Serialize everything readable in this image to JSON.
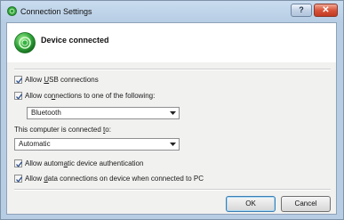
{
  "window": {
    "title": "Connection Settings",
    "help_label": "?",
    "close_label": "✕"
  },
  "header": {
    "status_text": "Device connected",
    "status_icon": "green-connected-orb-icon",
    "accent_color": "#2fa33a"
  },
  "options": {
    "allow_usb": {
      "checked": true,
      "pre": "Allow ",
      "key": "U",
      "post": "SB connections"
    },
    "allow_connections": {
      "checked": true,
      "pre": "Allow co",
      "key": "n",
      "post": "nections to one of the following:"
    },
    "connection_type": {
      "value": "Bluetooth"
    },
    "connected_to_label": {
      "pre": "This computer is connected ",
      "key": "t",
      "post": "o:"
    },
    "connected_to": {
      "value": "Automatic"
    },
    "allow_auth": {
      "checked": true,
      "pre": "Allow autom",
      "key": "a",
      "post": "tic device authentication"
    },
    "allow_data": {
      "checked": true,
      "pre": "Allow ",
      "key": "d",
      "post": "ata connections on device when connected to PC"
    }
  },
  "buttons": {
    "ok_label": "OK",
    "cancel_label": "Cancel"
  }
}
